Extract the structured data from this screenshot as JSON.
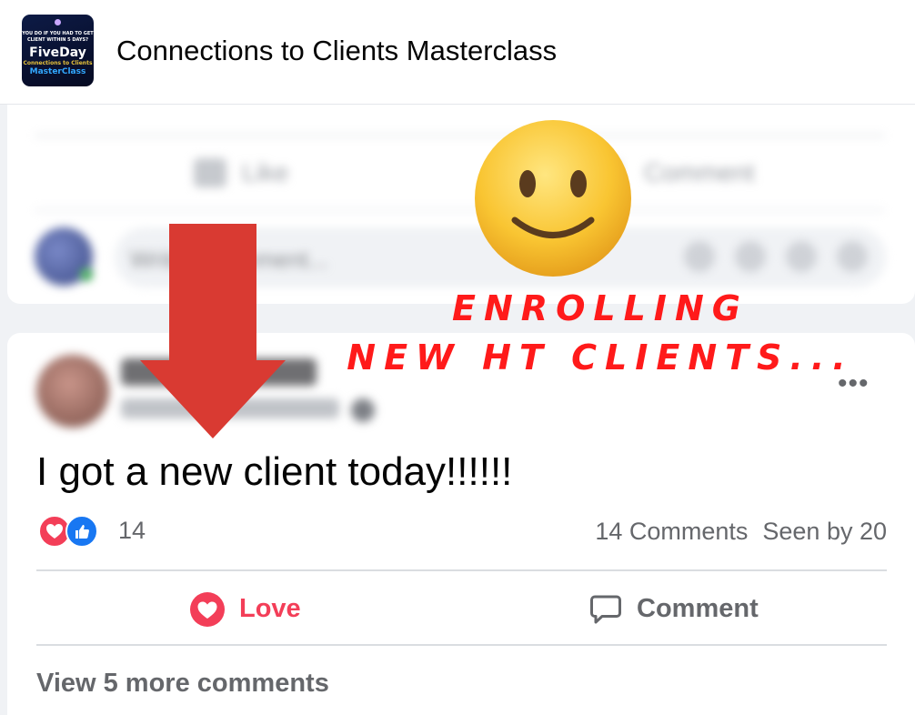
{
  "header": {
    "group_name": "Connections to Clients Masterclass",
    "thumbnail": {
      "small_text": "YOU DO IF YOU HAD TO GET CLIENT WITHIN 5 DAYS?",
      "brand": "FiveDay",
      "subtitle": "Connections to Clients",
      "master": "MasterClass"
    }
  },
  "overlay": {
    "caption_line1": "ENROLLING",
    "caption_line2": "NEW HT CLIENTS...",
    "colors": {
      "caption": "#ff1a1a",
      "arrow": "#d93a32"
    }
  },
  "previous_post": {
    "like_label": "Like",
    "comment_label": "Comment",
    "comment_placeholder": "Write a comment..."
  },
  "post": {
    "text": "I got a new client today!!!!!!",
    "reaction_count": "14",
    "comments_count": "14 Comments",
    "seen_by": "Seen by 20",
    "love_label": "Love",
    "comment_label": "Comment",
    "view_more": "View 5 more comments",
    "colors": {
      "love": "#f33e58",
      "like": "#1877f2"
    }
  }
}
